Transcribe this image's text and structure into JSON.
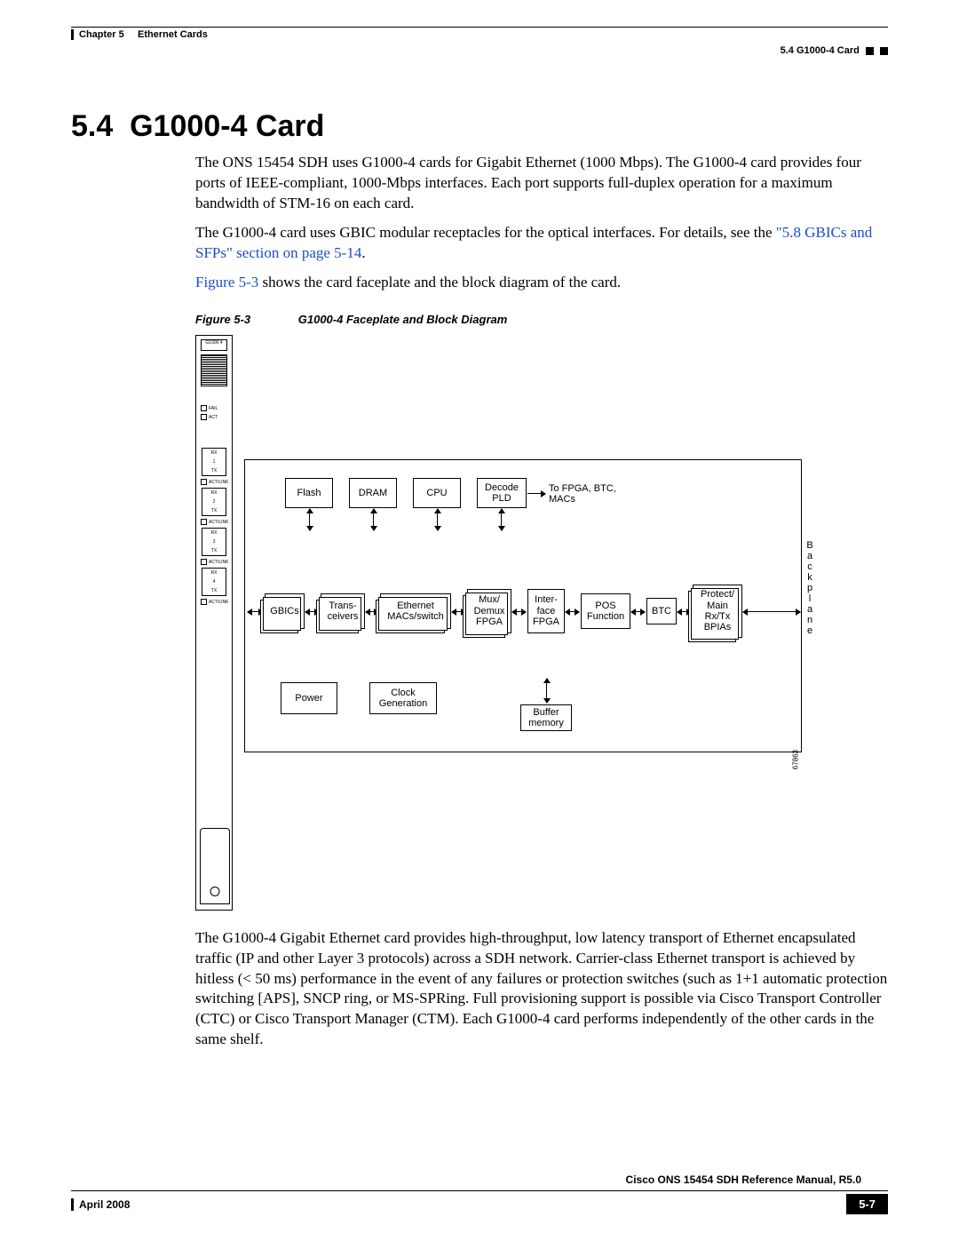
{
  "header": {
    "chapter": "Chapter 5",
    "chapter_title": "Ethernet Cards",
    "breadcrumb": "5.4  G1000-4 Card"
  },
  "section": {
    "number": "5.4",
    "title": "G1000-4 Card"
  },
  "paragraphs": {
    "p1": "The ONS 15454 SDH uses G1000-4 cards for Gigabit Ethernet (1000 Mbps). The G1000-4 card provides four ports of IEEE-compliant, 1000-Mbps interfaces. Each port supports full-duplex operation for a maximum bandwidth of STM-16 on each card.",
    "p2a": "The G1000-4 card uses GBIC modular receptacles for the optical interfaces. For details, see the ",
    "p2link": "\"5.8  GBICs and SFPs\" section on page 5-14",
    "p2b": ".",
    "p3a": "Figure 5-3",
    "p3b": " shows the card faceplate and the block diagram of the card.",
    "p4": "The G1000-4 Gigabit Ethernet card provides high-throughput, low latency transport of Ethernet encapsulated traffic (IP and other Layer 3 protocols) across a SDH network. Carrier-class Ethernet transport is achieved by hitless (< 50 ms) performance in the event of any failures or protection switches (such as 1+1 automatic protection switching [APS], SNCP ring, or MS-SPRing. Full provisioning support is possible via Cisco Transport Controller (CTC) or Cisco Transport Manager (CTM). Each G1000-4 card performs independently of the other cards in the same shelf."
  },
  "figure": {
    "label": "Figure 5-3",
    "caption": "G1000-4 Faceplate and Block Diagram",
    "id": "67863",
    "faceplate": {
      "card_label": "G1000 4",
      "leds": [
        "FAIL",
        "ACT"
      ],
      "port_labels": [
        "RX",
        "1",
        "TX",
        "ACT/LINK",
        "RX",
        "2",
        "TX",
        "ACT/LINK",
        "RX",
        "3",
        "TX",
        "ACT/LINK",
        "RX",
        "4",
        "TX",
        "ACT/LINK"
      ]
    },
    "blocks": {
      "flash": "Flash",
      "dram": "DRAM",
      "cpu": "CPU",
      "decode": "Decode PLD",
      "decode_out": "To FPGA, BTC, MACs",
      "gbics": "GBICs",
      "trans": "Trans-\nceivers",
      "mac": "Ethernet MACs/switch",
      "mux": "Mux/ Demux FPGA",
      "iface": "Inter-\nface FPGA",
      "pos": "POS Function",
      "btc": "BTC",
      "protect": "Protect/ Main Rx/Tx BPIAs",
      "power": "Power",
      "clock": "Clock Generation",
      "buffer": "Buffer memory",
      "backplane": "Backplane"
    }
  },
  "footer": {
    "manual": "Cisco ONS 15454 SDH Reference Manual, R5.0",
    "date": "April 2008",
    "page": "5-7"
  }
}
